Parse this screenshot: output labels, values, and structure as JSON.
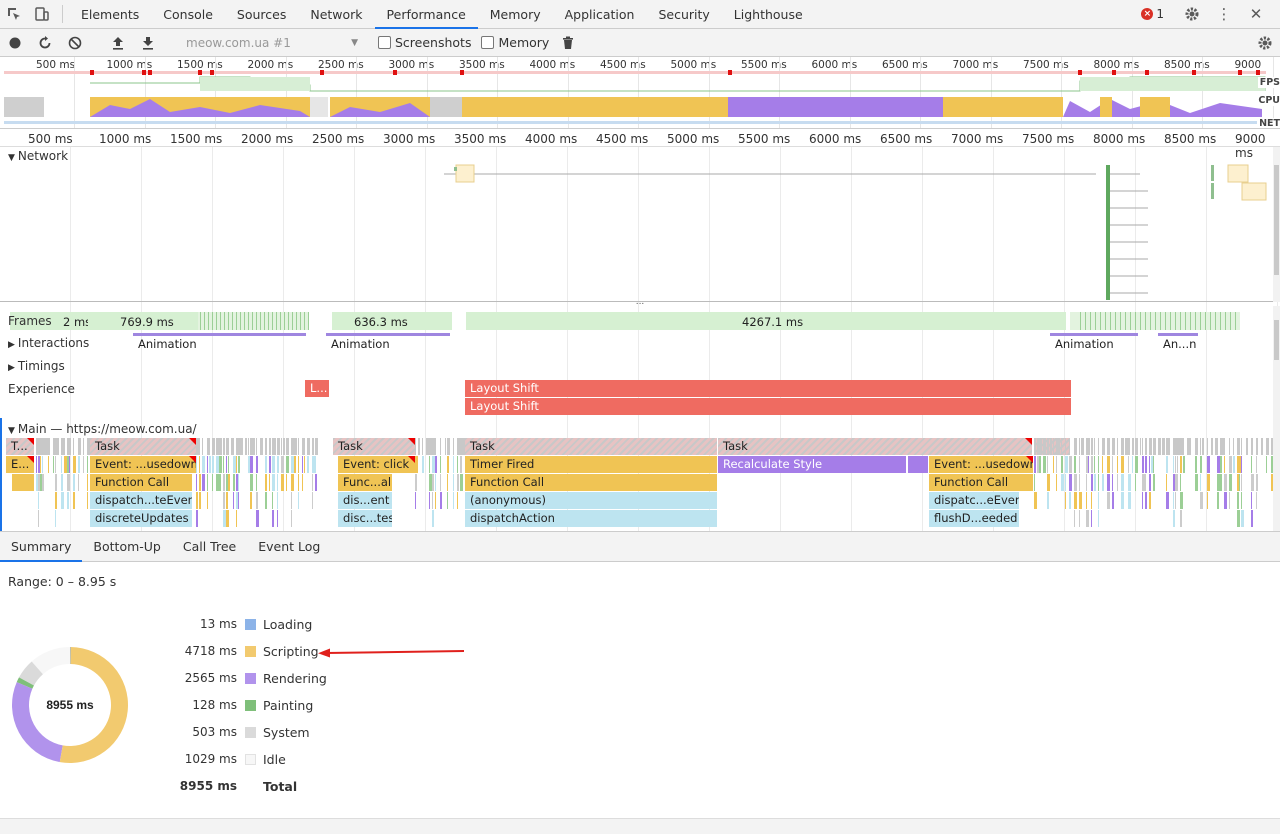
{
  "tabbar": {
    "tabs": [
      {
        "label": "Elements"
      },
      {
        "label": "Console"
      },
      {
        "label": "Sources"
      },
      {
        "label": "Network"
      },
      {
        "label": "Performance"
      },
      {
        "label": "Memory"
      },
      {
        "label": "Application"
      },
      {
        "label": "Security"
      },
      {
        "label": "Lighthouse"
      }
    ],
    "active_tab": "Performance",
    "error_count": "1"
  },
  "toolbar": {
    "profile": "meow.com.ua #1",
    "screenshots_label": "Screenshots",
    "memory_label": "Memory",
    "screenshots_checked": false,
    "memory_checked": false
  },
  "overview": {
    "ticks": [
      "500 ms",
      "1000 ms",
      "1500 ms",
      "2000 ms",
      "2500 ms",
      "3000 ms",
      "3500 ms",
      "4000 ms",
      "4500 ms",
      "5000 ms",
      "5500 ms",
      "6000 ms",
      "6500 ms",
      "7000 ms",
      "7500 ms",
      "8000 ms",
      "8500 ms",
      "9000"
    ],
    "fps_label": "FPS",
    "cpu_label": "CPU",
    "net_label": "NET"
  },
  "ruler": {
    "ticks": [
      "500 ms",
      "1000 ms",
      "1500 ms",
      "2000 ms",
      "2500 ms",
      "3000 ms",
      "3500 ms",
      "4000 ms",
      "4500 ms",
      "5000 ms",
      "5500 ms",
      "6000 ms",
      "6500 ms",
      "7000 ms",
      "7500 ms",
      "8000 ms",
      "8500 ms",
      "9000 ms"
    ]
  },
  "network": {
    "title": "Network"
  },
  "tracks": {
    "frames_label": "Frames",
    "frames": [
      "2 ms",
      "769.9 ms",
      "636.3 ms",
      "4267.1 ms"
    ],
    "interactions_label": "Interactions",
    "interactions": [
      "Animation",
      "Animation",
      "Animation",
      "An...n"
    ],
    "timings_label": "Timings",
    "experience_label": "Experience",
    "experience": [
      "L...",
      "Layout Shift",
      "Layout Shift"
    ],
    "main_label": "Main — https://meow.com.ua/",
    "tasks": [
      "T...",
      "Task",
      "Task",
      "Task",
      "Task"
    ],
    "level1": [
      "E...",
      "Event: ...usedown",
      "Event: click",
      "Timer Fired",
      "Recalculate Style",
      "Event: ...usedown"
    ],
    "level2": [
      "Function Call",
      "Func...all",
      "Function Call",
      "Function Call"
    ],
    "level3": [
      "dispatch...teEvent",
      "dis...ent",
      "(anonymous)",
      "dispatc...eEvent"
    ],
    "level4": [
      "discreteUpdates",
      "disc...tes",
      "dispatchAction",
      "flushD...eeded"
    ]
  },
  "bottom_tabs": {
    "tabs": [
      {
        "label": "Summary"
      },
      {
        "label": "Bottom-Up"
      },
      {
        "label": "Call Tree"
      },
      {
        "label": "Event Log"
      }
    ],
    "active_tab": "Summary"
  },
  "summary": {
    "range": "Range: 0 – 8.95 s",
    "total_center": "8955 ms",
    "categories": [
      {
        "value": "13 ms",
        "name": "Loading",
        "ms": 13,
        "color": "#8cb3e8"
      },
      {
        "value": "4718 ms",
        "name": "Scripting",
        "ms": 4718,
        "color": "#f2ca6f"
      },
      {
        "value": "2565 ms",
        "name": "Rendering",
        "ms": 2565,
        "color": "#b193ec"
      },
      {
        "value": "128 ms",
        "name": "Painting",
        "ms": 128,
        "color": "#7fbf7a"
      },
      {
        "value": "503 ms",
        "name": "System",
        "ms": 503,
        "color": "#dadada"
      },
      {
        "value": "1029 ms",
        "name": "Idle",
        "ms": 1029,
        "color": "#f7f7f7"
      }
    ],
    "total": {
      "value": "8955 ms",
      "name": "Total"
    }
  },
  "colors": {
    "accent": "#1a73e8",
    "annotation_arrow": "#e0201c"
  }
}
